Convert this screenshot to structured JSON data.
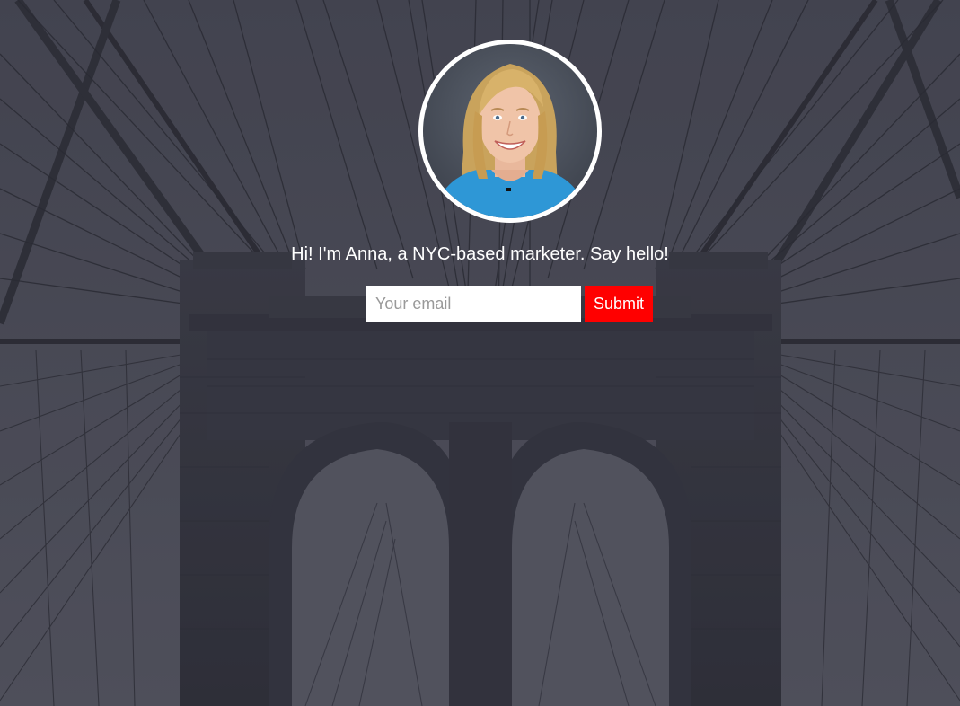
{
  "hero": {
    "intro_text": "Hi! I'm Anna, a NYC-based marketer. Say hello!",
    "background_image": "brooklyn-bridge-photo",
    "overlay_color": "#3f404a"
  },
  "avatar": {
    "image": "portrait-photo",
    "border_color": "#ffffff"
  },
  "signup_form": {
    "email_placeholder": "Your email",
    "email_value": "",
    "submit_label": "Submit",
    "submit_color": "#ff0000"
  }
}
